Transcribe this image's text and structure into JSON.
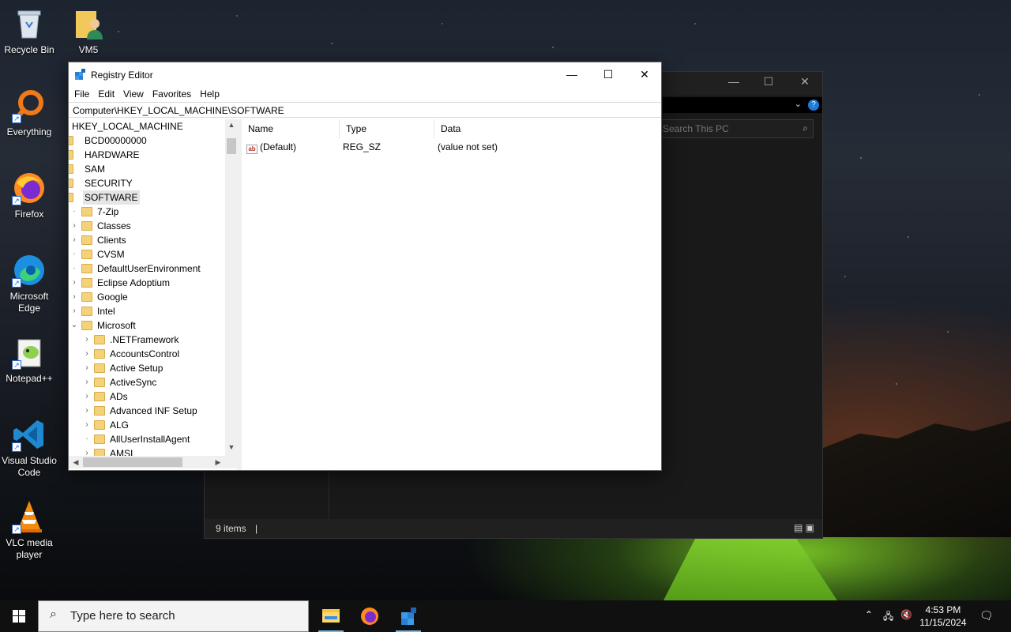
{
  "desktop": {
    "icons": [
      {
        "label": "Recycle Bin"
      },
      {
        "label": "VM5"
      },
      {
        "label": "Everything"
      },
      {
        "label": "Firefox"
      },
      {
        "label": "Microsoft Edge"
      },
      {
        "label": "Notepad++"
      },
      {
        "label": "Visual Studio Code"
      },
      {
        "label": "VLC media player"
      }
    ]
  },
  "explorer": {
    "search_placeholder": "Search This PC",
    "status": "9 items"
  },
  "regedit": {
    "title": "Registry Editor",
    "menu": [
      "File",
      "Edit",
      "View",
      "Favorites",
      "Help"
    ],
    "address": "Computer\\HKEY_LOCAL_MACHINE\\SOFTWARE",
    "tree": {
      "root": "HKEY_LOCAL_MACHINE",
      "hklm_children": [
        "BCD00000000",
        "HARDWARE",
        "SAM",
        "SECURITY",
        "SOFTWARE"
      ],
      "software_children": [
        "7-Zip",
        "Classes",
        "Clients",
        "CVSM",
        "DefaultUserEnvironment",
        "Eclipse Adoptium",
        "Google",
        "Intel",
        "Microsoft"
      ],
      "microsoft_children": [
        ".NETFramework",
        "AccountsControl",
        "Active Setup",
        "ActiveSync",
        "ADs",
        "Advanced INF Setup",
        "ALG",
        "AllUserInstallAgent",
        "AMSI"
      ]
    },
    "columns": {
      "name": "Name",
      "type": "Type",
      "data": "Data"
    },
    "values": [
      {
        "name": "(Default)",
        "type": "REG_SZ",
        "data": "(value not set)"
      }
    ]
  },
  "taskbar": {
    "search_placeholder": "Type here to search",
    "time": "4:53 PM",
    "date": "11/15/2024"
  }
}
